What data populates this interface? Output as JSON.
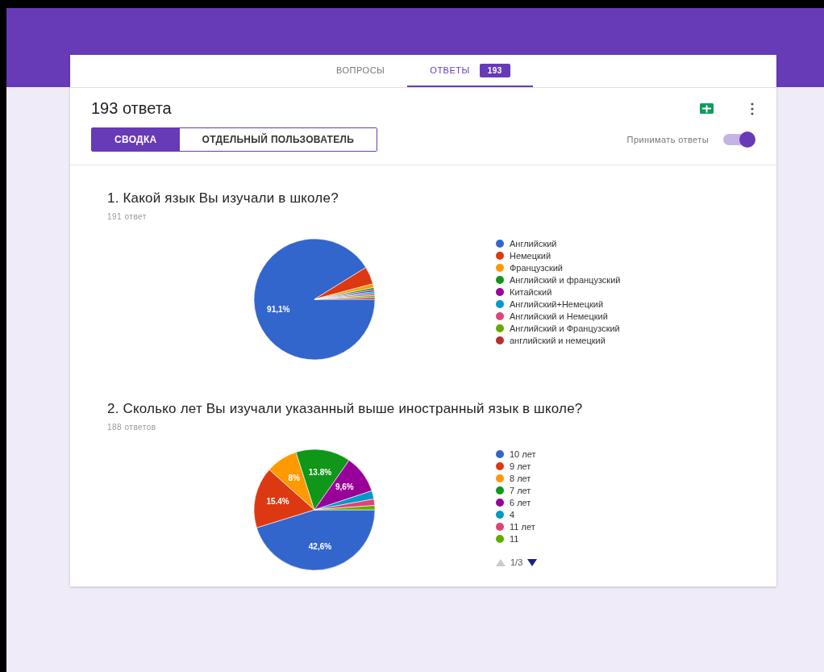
{
  "tabs": [
    {
      "label": "ВОПРОСЫ",
      "selected": false
    },
    {
      "label": "ОТВЕТЫ",
      "selected": true,
      "badge": "193"
    }
  ],
  "summary": {
    "title": "193 ответа",
    "view_buttons": [
      {
        "label": "СВОДКА",
        "selected": true
      },
      {
        "label": "ОТДЕЛЬНЫЙ ПОЛЬЗОВАТЕЛЬ",
        "selected": false
      }
    ],
    "accept_label": "Принимать ответы",
    "accept_on": true
  },
  "questions": [
    {
      "title": "1. Какой язык Вы изучали в школе?",
      "count": "191 ответ",
      "chart_data": {
        "type": "pie",
        "legend": "right",
        "categories": [
          "Английский",
          "Немецкий",
          "Французский",
          "Английский и французский",
          "Китайский",
          "Английский+Немецкий",
          "Английский и Немецкий",
          "Английский и Французский",
          "английский и немецкий"
        ],
        "values": [
          91.1,
          4.7,
          1.0,
          0.6,
          0.5,
          0.5,
          0.5,
          0.5,
          0.5
        ],
        "colors": [
          "#3366cc",
          "#dc3912",
          "#ff9900",
          "#109618",
          "#990099",
          "#0099c6",
          "#dd4477",
          "#66aa00",
          "#b82e2e"
        ],
        "value_labels": [
          "91,1%",
          null,
          null,
          null,
          null,
          null,
          null,
          null,
          null
        ]
      }
    },
    {
      "title": "2. Сколько лет Вы изучали указанный выше иностранный язык в школе?",
      "count": "188 ответов",
      "legend_page": "1/3",
      "chart_data": {
        "type": "pie",
        "legend": "right",
        "categories": [
          "10 лет",
          "9 лет",
          "8 лет",
          "7 лет",
          "6 лет",
          "4",
          "11 лет",
          "11"
        ],
        "values": [
          42.6,
          15.4,
          8,
          13.8,
          9.6,
          2.1,
          1.6,
          1.1
        ],
        "colors": [
          "#3366cc",
          "#dc3912",
          "#ff9900",
          "#109618",
          "#990099",
          "#0099c6",
          "#dd4477",
          "#66aa00"
        ],
        "value_labels": [
          "42,6%",
          "15.4%",
          "8%",
          "13.8%",
          "9,6%",
          null,
          null,
          null
        ]
      }
    }
  ]
}
